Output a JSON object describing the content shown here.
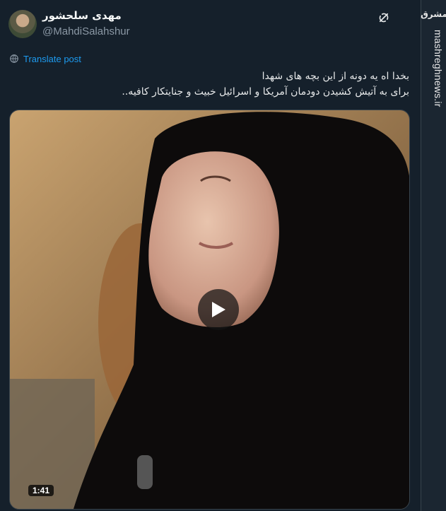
{
  "author": {
    "display_name": "مهدی سلحشور",
    "handle": "@MahdiSalahshur"
  },
  "translate": {
    "label": "Translate post"
  },
  "tweet": {
    "lines": [
      "بخدا اه یه دونه از این بچه های شهدا",
      "برای به آتیش کشیدن دودمان آمریکا و اسرائیل خبیث و جنایتکار کافیه.."
    ]
  },
  "media": {
    "duration": "1:41"
  },
  "watermark": {
    "logo_text": "مشرق",
    "site": "mashreghnews.ir"
  },
  "colors": {
    "background": "#15202b",
    "link": "#1d9bf0",
    "secondary_text": "#8b98a5"
  },
  "icons": [
    "grok-icon",
    "globe-translate-icon",
    "play-icon"
  ]
}
